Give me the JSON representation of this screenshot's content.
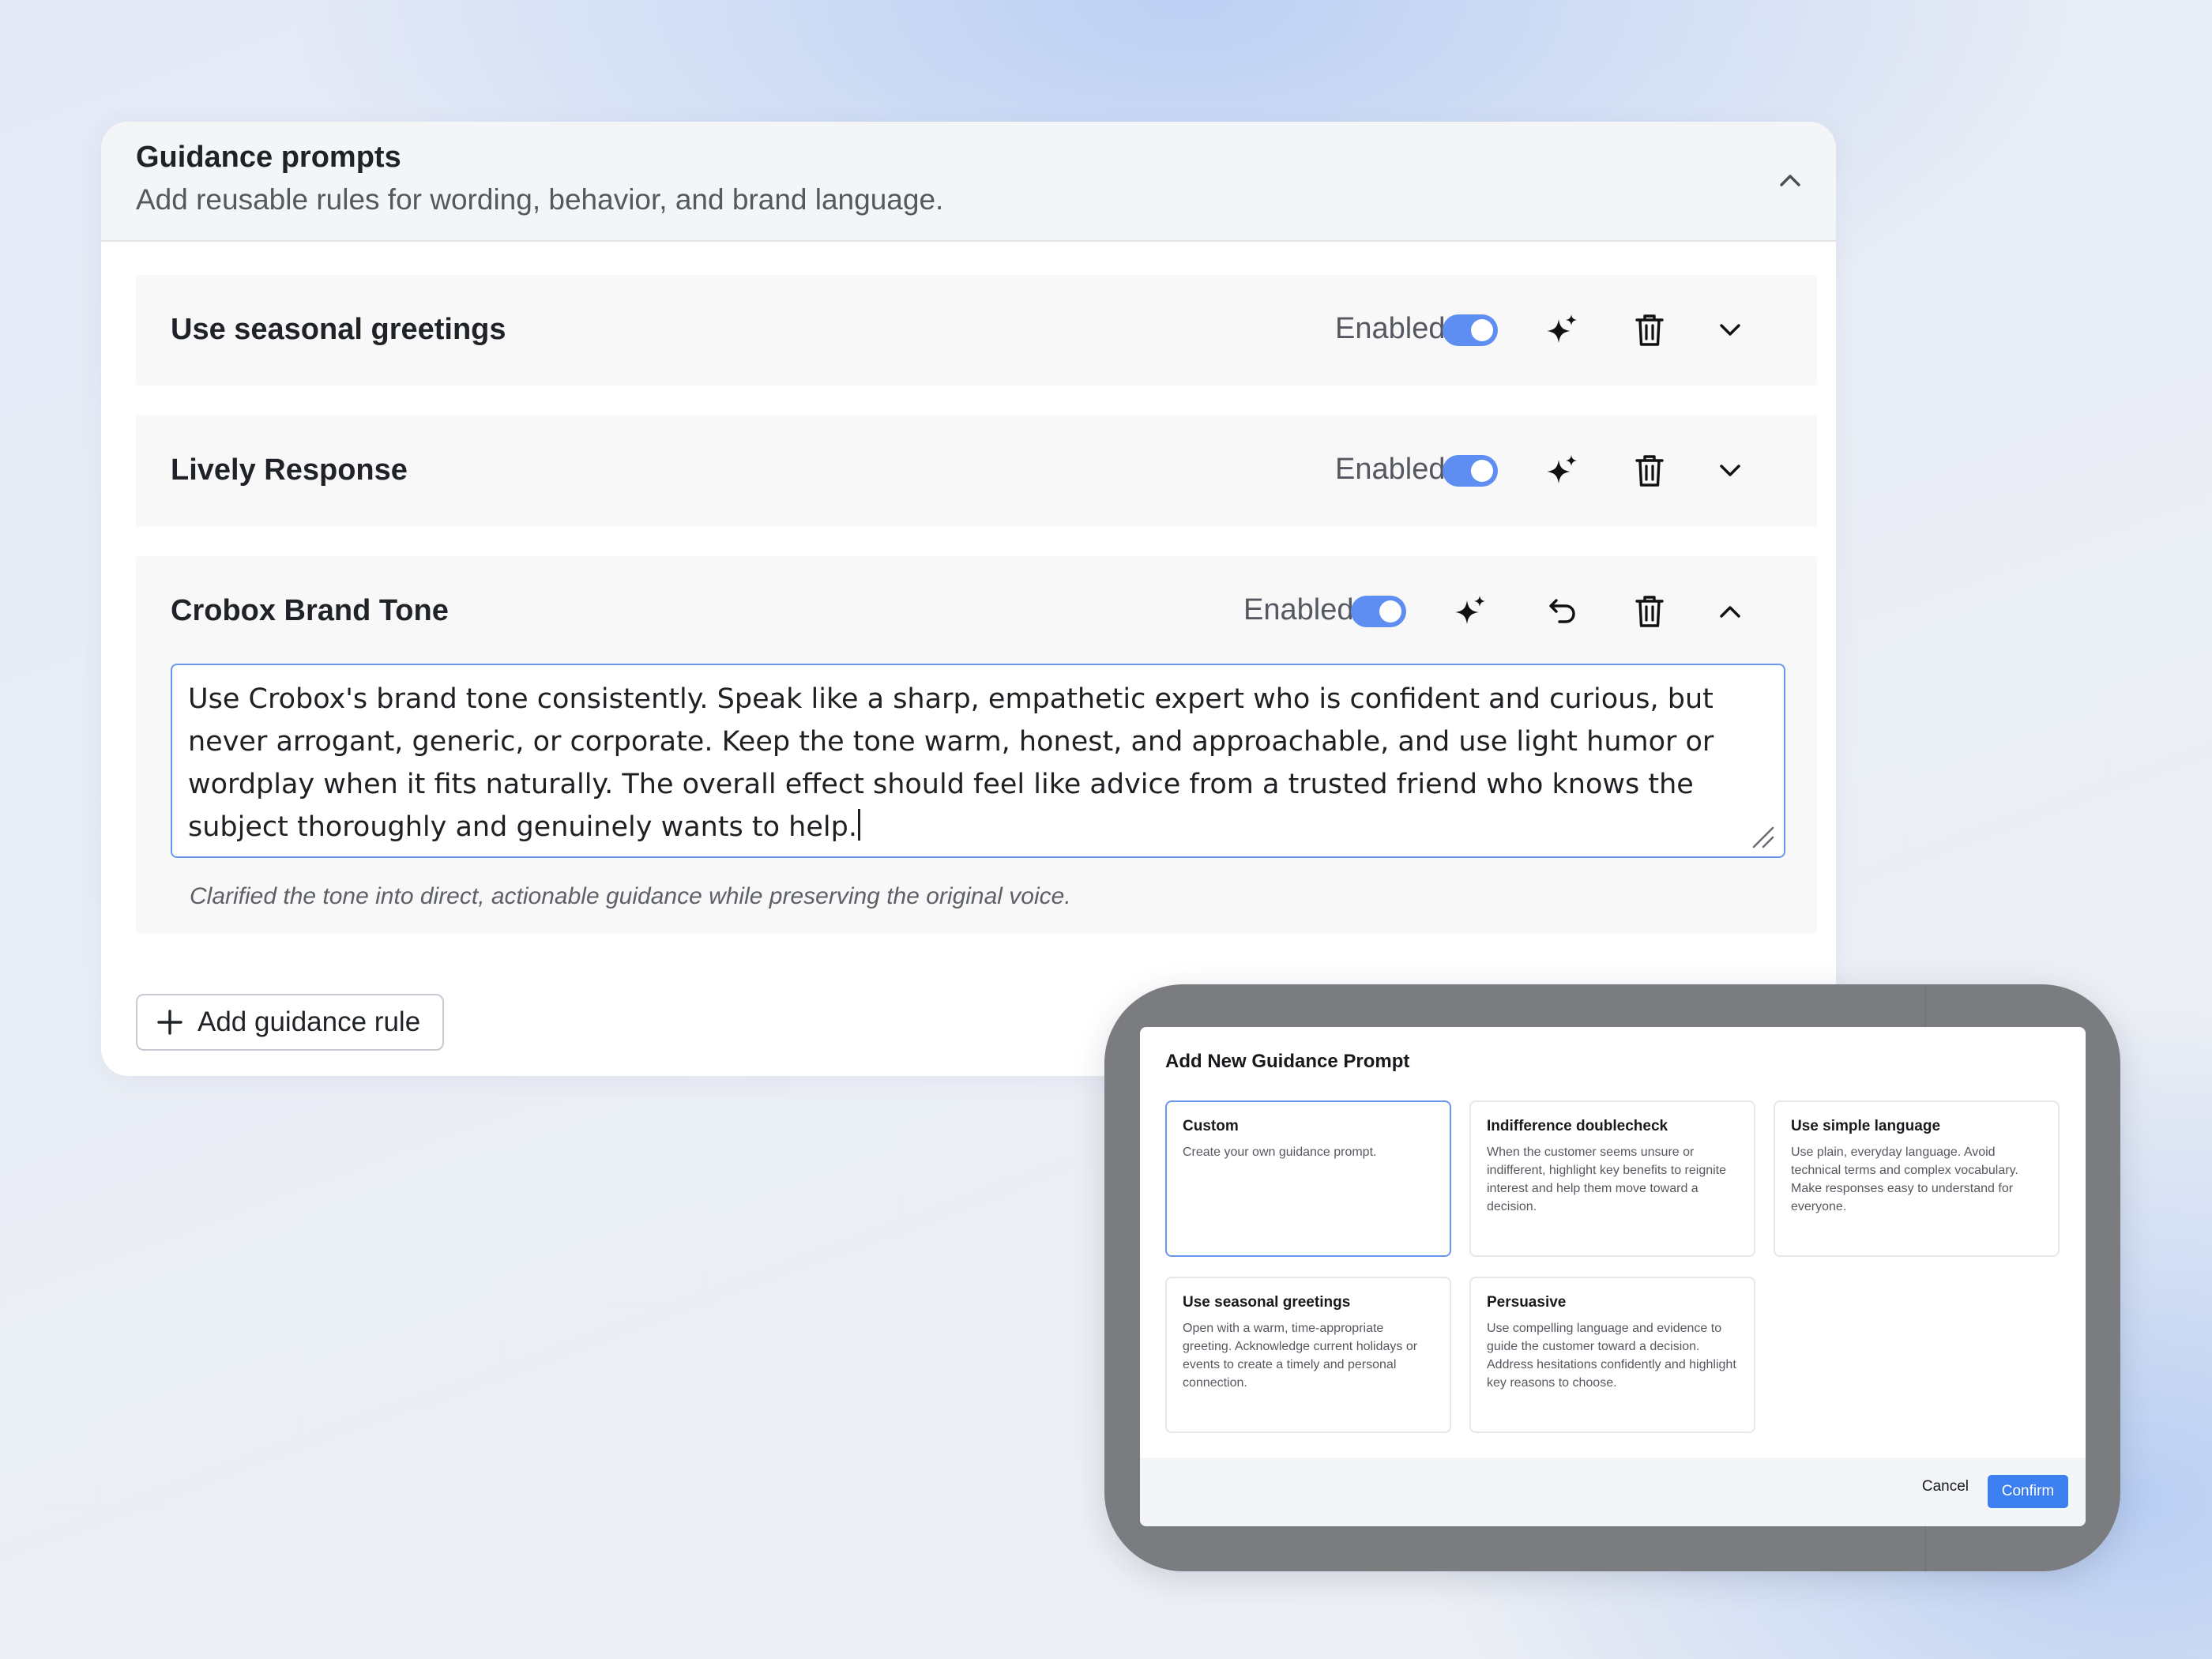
{
  "panel": {
    "title": "Guidance prompts",
    "subtitle": "Add reusable rules for wording, behavior, and brand language.",
    "collapse_icon": "chevron-up-icon"
  },
  "rules": [
    {
      "title": "Use seasonal greetings",
      "status_label": "Enabled",
      "enabled": true,
      "expanded": false,
      "icons": [
        "sparkle-icon",
        "trash-icon",
        "chevron-down-icon"
      ]
    },
    {
      "title": "Lively Response",
      "status_label": "Enabled",
      "enabled": true,
      "expanded": false,
      "icons": [
        "sparkle-icon",
        "trash-icon",
        "chevron-down-icon"
      ]
    },
    {
      "title": "Crobox Brand Tone",
      "status_label": "Enabled",
      "enabled": true,
      "expanded": true,
      "icons": [
        "sparkle-icon",
        "undo-icon",
        "trash-icon",
        "chevron-up-icon"
      ],
      "text": "Use Crobox's brand tone consistently. Speak like a sharp, empathetic expert who is confident and curious, but never arrogant, generic, or corporate. Keep the tone warm, honest, and approachable, and use light humor or wordplay when it fits naturally. The overall effect should feel like advice from a trusted friend who knows the subject thoroughly and genuinely wants to help.",
      "note": "Clarified the tone into direct, actionable guidance while preserving the original voice."
    }
  ],
  "add_rule_label": "Add guidance rule",
  "modal": {
    "title": "Add New Guidance Prompt",
    "templates": [
      {
        "name": "Custom",
        "description": "Create your own guidance prompt.",
        "selected": true
      },
      {
        "name": "Indifference doublecheck",
        "description": "When the customer seems unsure or indifferent, highlight key benefits to reignite interest and help them move toward a decision.",
        "selected": false
      },
      {
        "name": "Use simple language",
        "description": "Use plain, everyday language. Avoid technical terms and complex vocabulary. Make responses easy to understand for everyone.",
        "selected": false
      },
      {
        "name": "Use seasonal greetings",
        "description": "Open with a warm, time-appropriate greeting. Acknowledge current holidays or events to create a timely and personal connection.",
        "selected": false
      },
      {
        "name": "Persuasive",
        "description": "Use compelling language and evidence to guide the customer toward a decision. Address hesitations confidently and highlight key reasons to choose.",
        "selected": false
      }
    ],
    "cancel_label": "Cancel",
    "confirm_label": "Confirm"
  },
  "colors": {
    "accent": "#5e8ef2",
    "confirm": "#3c7ff1",
    "focus_border": "#6a97ec"
  }
}
